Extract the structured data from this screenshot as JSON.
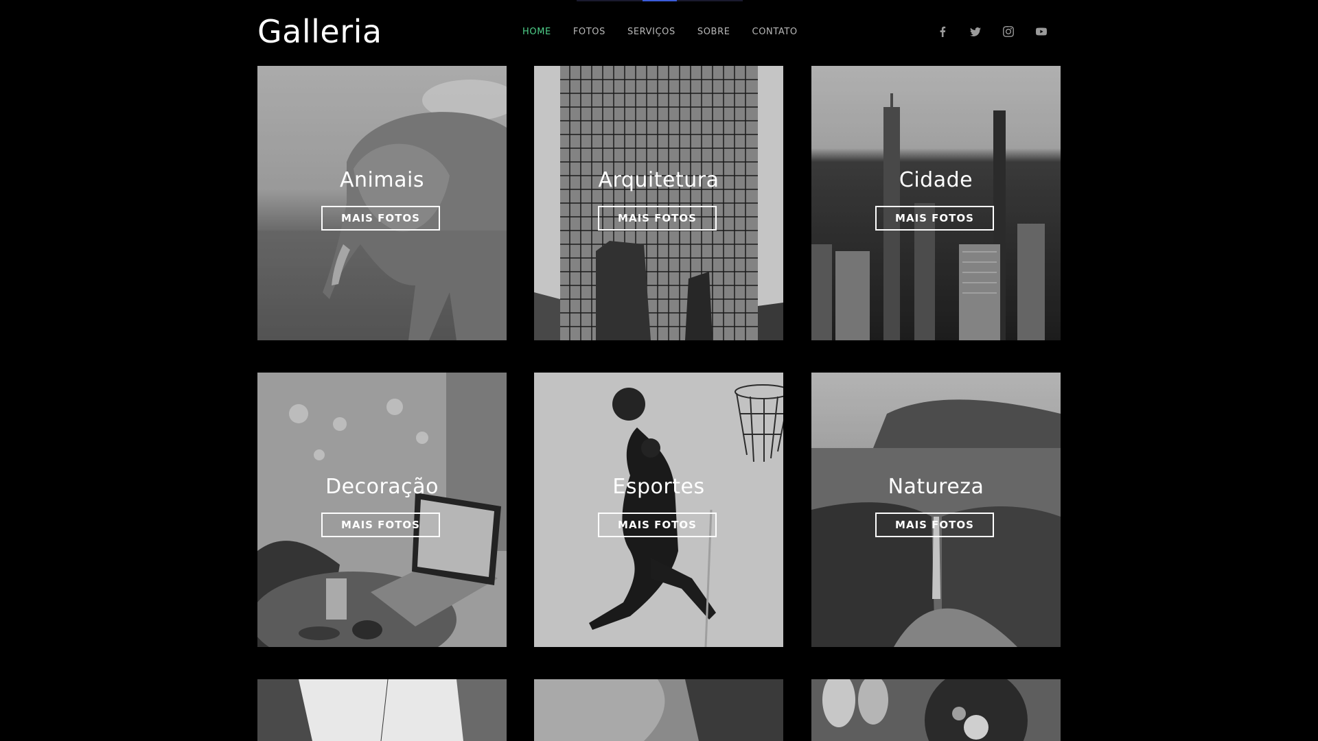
{
  "header": {
    "logo": "Galleria",
    "nav": [
      {
        "label": "HOME",
        "active": true
      },
      {
        "label": "FOTOS",
        "active": false
      },
      {
        "label": "SERVIÇOS",
        "active": false
      },
      {
        "label": "SOBRE",
        "active": false
      },
      {
        "label": "CONTATO",
        "active": false
      }
    ],
    "social": [
      "facebook-icon",
      "twitter-icon",
      "instagram-icon",
      "youtube-icon"
    ]
  },
  "colors": {
    "background": "#000000",
    "nav_active": "#4fd08a",
    "nav_text": "#b8b8b8"
  },
  "gallery": [
    {
      "title": "Animais",
      "button": "MAIS FOTOS"
    },
    {
      "title": "Arquitetura",
      "button": "MAIS FOTOS"
    },
    {
      "title": "Cidade",
      "button": "MAIS FOTOS"
    },
    {
      "title": "Decoração",
      "button": "MAIS FOTOS"
    },
    {
      "title": "Esportes",
      "button": "MAIS FOTOS"
    },
    {
      "title": "Natureza",
      "button": "MAIS FOTOS"
    },
    {
      "title": "",
      "button": ""
    },
    {
      "title": "",
      "button": ""
    },
    {
      "title": "",
      "button": ""
    }
  ]
}
